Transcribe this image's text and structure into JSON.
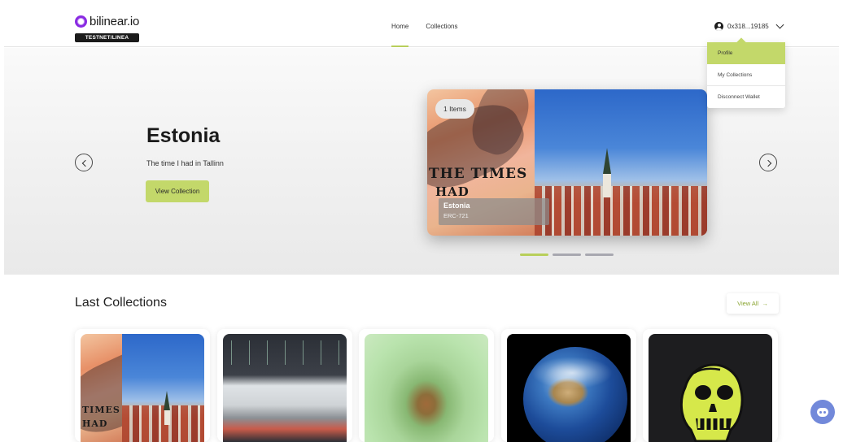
{
  "brand": {
    "name": "bilinear.io",
    "network_badge": "TESTNET/LINEA",
    "logo_color": "#8a2be2"
  },
  "nav": {
    "items": [
      {
        "label": "Home",
        "active": true
      },
      {
        "label": "Collections",
        "active": false
      }
    ]
  },
  "wallet": {
    "address": "0x318...19185",
    "icon": "user-circle-icon"
  },
  "dropdown": {
    "items": [
      {
        "label": "Profile",
        "active": true
      },
      {
        "label": "My Collections",
        "active": false
      },
      {
        "label": "Disconnect Wallet",
        "active": false
      }
    ]
  },
  "hero": {
    "title": "Estonia",
    "subtitle": "The time I had in Tallinn",
    "cta_label": "View Collection",
    "card": {
      "items_count": "1 Items",
      "name": "Estonia",
      "standard": "ERC-721",
      "image_text": [
        "THE TIMES",
        "HAD"
      ]
    },
    "slides": 3,
    "active_slide": 0
  },
  "last_collections": {
    "title": "Last Collections",
    "view_all_label": "View All",
    "cards": [
      {
        "image": "tallinn-collage",
        "image_text": [
          "TIMES",
          "HAD"
        ]
      },
      {
        "image": "gallery-building"
      },
      {
        "image": "green-blur"
      },
      {
        "image": "earth"
      },
      {
        "image": "bored-ape-skull"
      }
    ]
  },
  "colors": {
    "accent": "#c3d86a",
    "accent_dark": "#b8cf5b",
    "link_green": "#8aa531",
    "discord": "#7289da"
  }
}
